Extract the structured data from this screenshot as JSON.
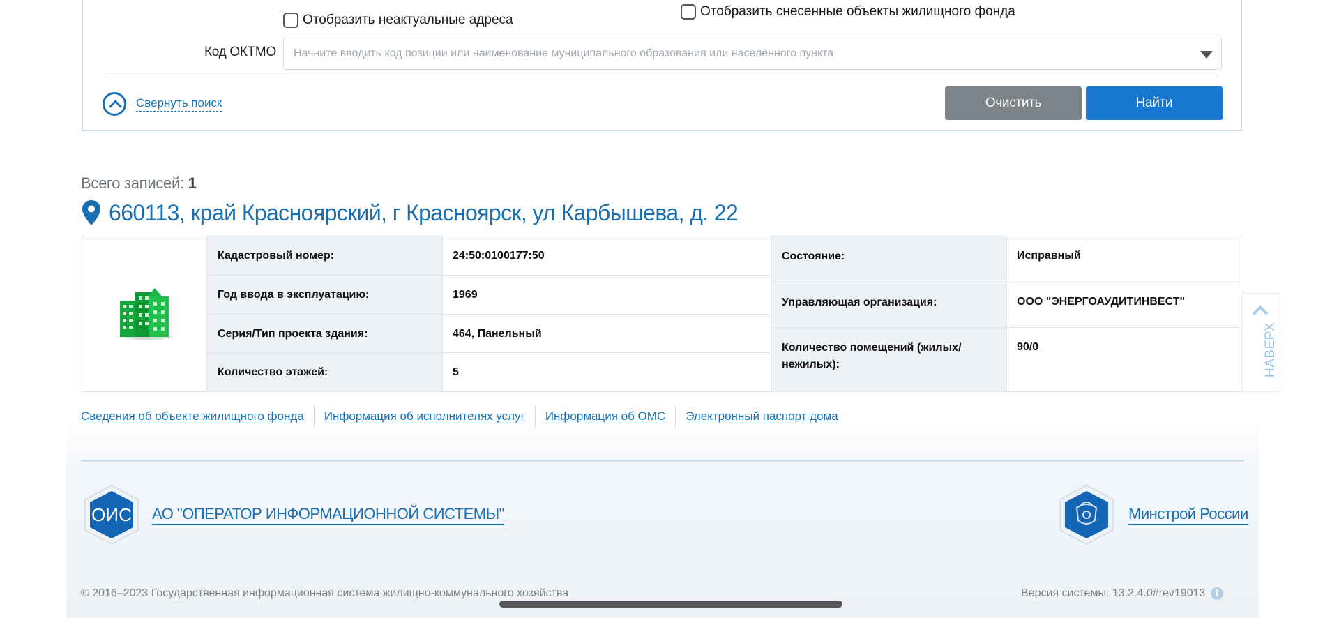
{
  "search": {
    "show_inactive_addresses": "Отобразить неактуальные адреса",
    "show_demolished": "Отобразить снесенные объекты жилищного фонда",
    "oktmo_label": "Код ОКТМО",
    "oktmo_placeholder": "Начните вводить код позиции или наименование муниципального образования или населённого пункта",
    "collapse_label": "Свернуть поиск",
    "clear_label": "Очистить",
    "find_label": "Найти"
  },
  "results": {
    "total_label": "Всего записей:",
    "total_count": "1",
    "address": "660113, край Красноярский, г Красноярск, ул Карбышева, д. 22",
    "left": [
      {
        "key": "Кадастровый номер:",
        "value": "24:50:0100177:50"
      },
      {
        "key": "Год ввода в эксплуатацию:",
        "value": "1969"
      },
      {
        "key": "Серия/Тип проекта здания:",
        "value": "464, Панельный"
      },
      {
        "key": "Количество этажей:",
        "value": "5"
      }
    ],
    "right": [
      {
        "key": "Состояние:",
        "value": "Исправный"
      },
      {
        "key": "Управляющая организация:",
        "value": "ООО \"ЭНЕРГОАУДИТИНВЕСТ\""
      },
      {
        "key": "Количество помещений (жилых/нежилых):",
        "value": "90/0"
      }
    ],
    "links": [
      "Сведения об объекте жилищного фонда",
      "Информация об исполнителях услуг",
      "Информация об ОМС",
      "Электронный паспорт дома"
    ]
  },
  "to_top": "НАВЕРХ",
  "footer": {
    "ois_badge": "ОИС",
    "operator_link": "АО \"ОПЕРАТОР ИНФОРМАЦИОННОЙ СИСТЕМЫ\"",
    "minstroy_link": "Минстрой России",
    "copyright": "© 2016–2023 Государственная информационная система жилищно-коммунального хозяйства",
    "version": "Версия системы: 13.2.4.0#rev19013"
  },
  "colors": {
    "accent": "#1a73b9",
    "find_button": "#1679cf",
    "clear_button": "#7c8389"
  }
}
